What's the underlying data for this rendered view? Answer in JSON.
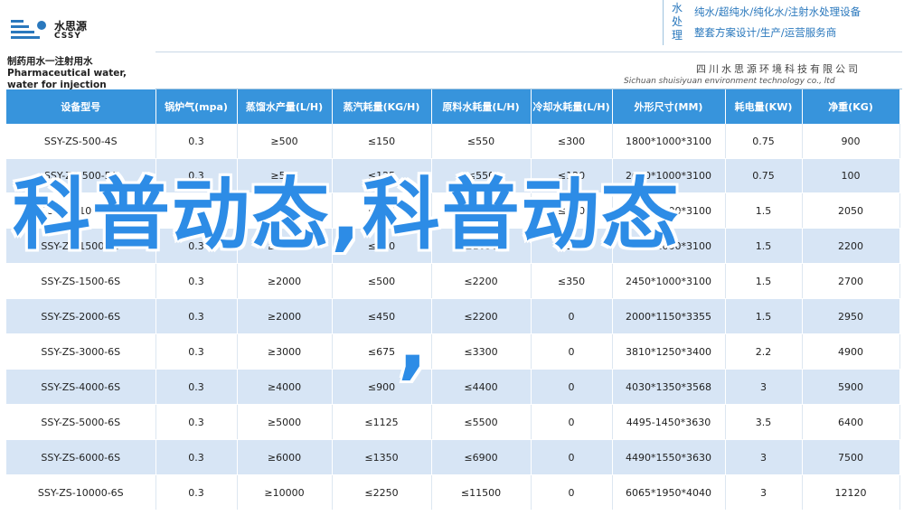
{
  "brand": {
    "name_cn": "水思源",
    "name_en": "CSSY",
    "accent_color": "#2a78bd"
  },
  "slogan": {
    "vertical": "水处理",
    "line1": "纯水/超纯水/纯化水/注射水处理设备",
    "line2": "整套方案设计/生产/运营服务商"
  },
  "subtitle": "制药用水一注射用水 Pharmaceutical water, water for injection",
  "company": {
    "cn": "四川水思源环境科技有限公司",
    "en": "Sichuan shuisiyuan environment technology co., ltd"
  },
  "table": {
    "header_color": "#3794dc",
    "columns": [
      "设备型号",
      "锅炉气(mpa)",
      "蒸馏水产量(L/H)",
      "蒸汽耗量(KG/H)",
      "原料水耗量(L/H)",
      "冷却水耗量(L/H)",
      "外形尺寸(MM)",
      "耗电量(KW)",
      "净重(KG)"
    ],
    "rows": [
      [
        "SSY-ZS-500-4S",
        "0.3",
        "≥500",
        "≤150",
        "≤550",
        "≤300",
        "1800*1000*3100",
        "0.75",
        "900"
      ],
      [
        "SSY-ZS-500-5S",
        "0.3",
        "≥500",
        "≤125",
        "≤550",
        "≤120",
        "2000*1000*3100",
        "0.75",
        "100"
      ],
      [
        "SSY-ZS-1000-5S",
        "0.3",
        "≥1000",
        "≤250",
        "≤1100",
        "≤250",
        "2000*1000*3100",
        "1.5",
        "2050"
      ],
      [
        "SSY-ZS-1500-6S",
        "0.3",
        "≥1500",
        "≤400",
        "≤1650",
        "≤500",
        "2450*1000*3100",
        "1.5",
        "2200"
      ],
      [
        "SSY-ZS-1500-6S",
        "0.3",
        "≥2000",
        "≤500",
        "≤2200",
        "≤350",
        "2450*1000*3100",
        "1.5",
        "2700"
      ],
      [
        "SSY-ZS-2000-6S",
        "0.3",
        "≥2000",
        "≤450",
        "≤2200",
        "0",
        "2000*1150*3355",
        "1.5",
        "2950"
      ],
      [
        "SSY-ZS-3000-6S",
        "0.3",
        "≥3000",
        "≤675",
        "≤3300",
        "0",
        "3810*1250*3400",
        "2.2",
        "4900"
      ],
      [
        "SSY-ZS-4000-6S",
        "0.3",
        "≥4000",
        "≤900",
        "≤4400",
        "0",
        "4030*1350*3568",
        "3",
        "5900"
      ],
      [
        "SSY-ZS-5000-6S",
        "0.3",
        "≥5000",
        "≤1125",
        "≤5500",
        "0",
        "4495-1450*3630",
        "3.5",
        "6400"
      ],
      [
        "SSY-ZS-6000-6S",
        "0.3",
        "≥6000",
        "≤1350",
        "≤6900",
        "0",
        "4490*1550*3630",
        "3",
        "7500"
      ],
      [
        "SSY-ZS-10000-6S",
        "0.3",
        "≥10000",
        "≤2250",
        "≤11500",
        "0",
        "6065*1950*4040",
        "3",
        "12120"
      ]
    ]
  },
  "watermark": {
    "text": "科普动态,科普动态",
    "comma": ",",
    "color": "#2d8ce6"
  }
}
